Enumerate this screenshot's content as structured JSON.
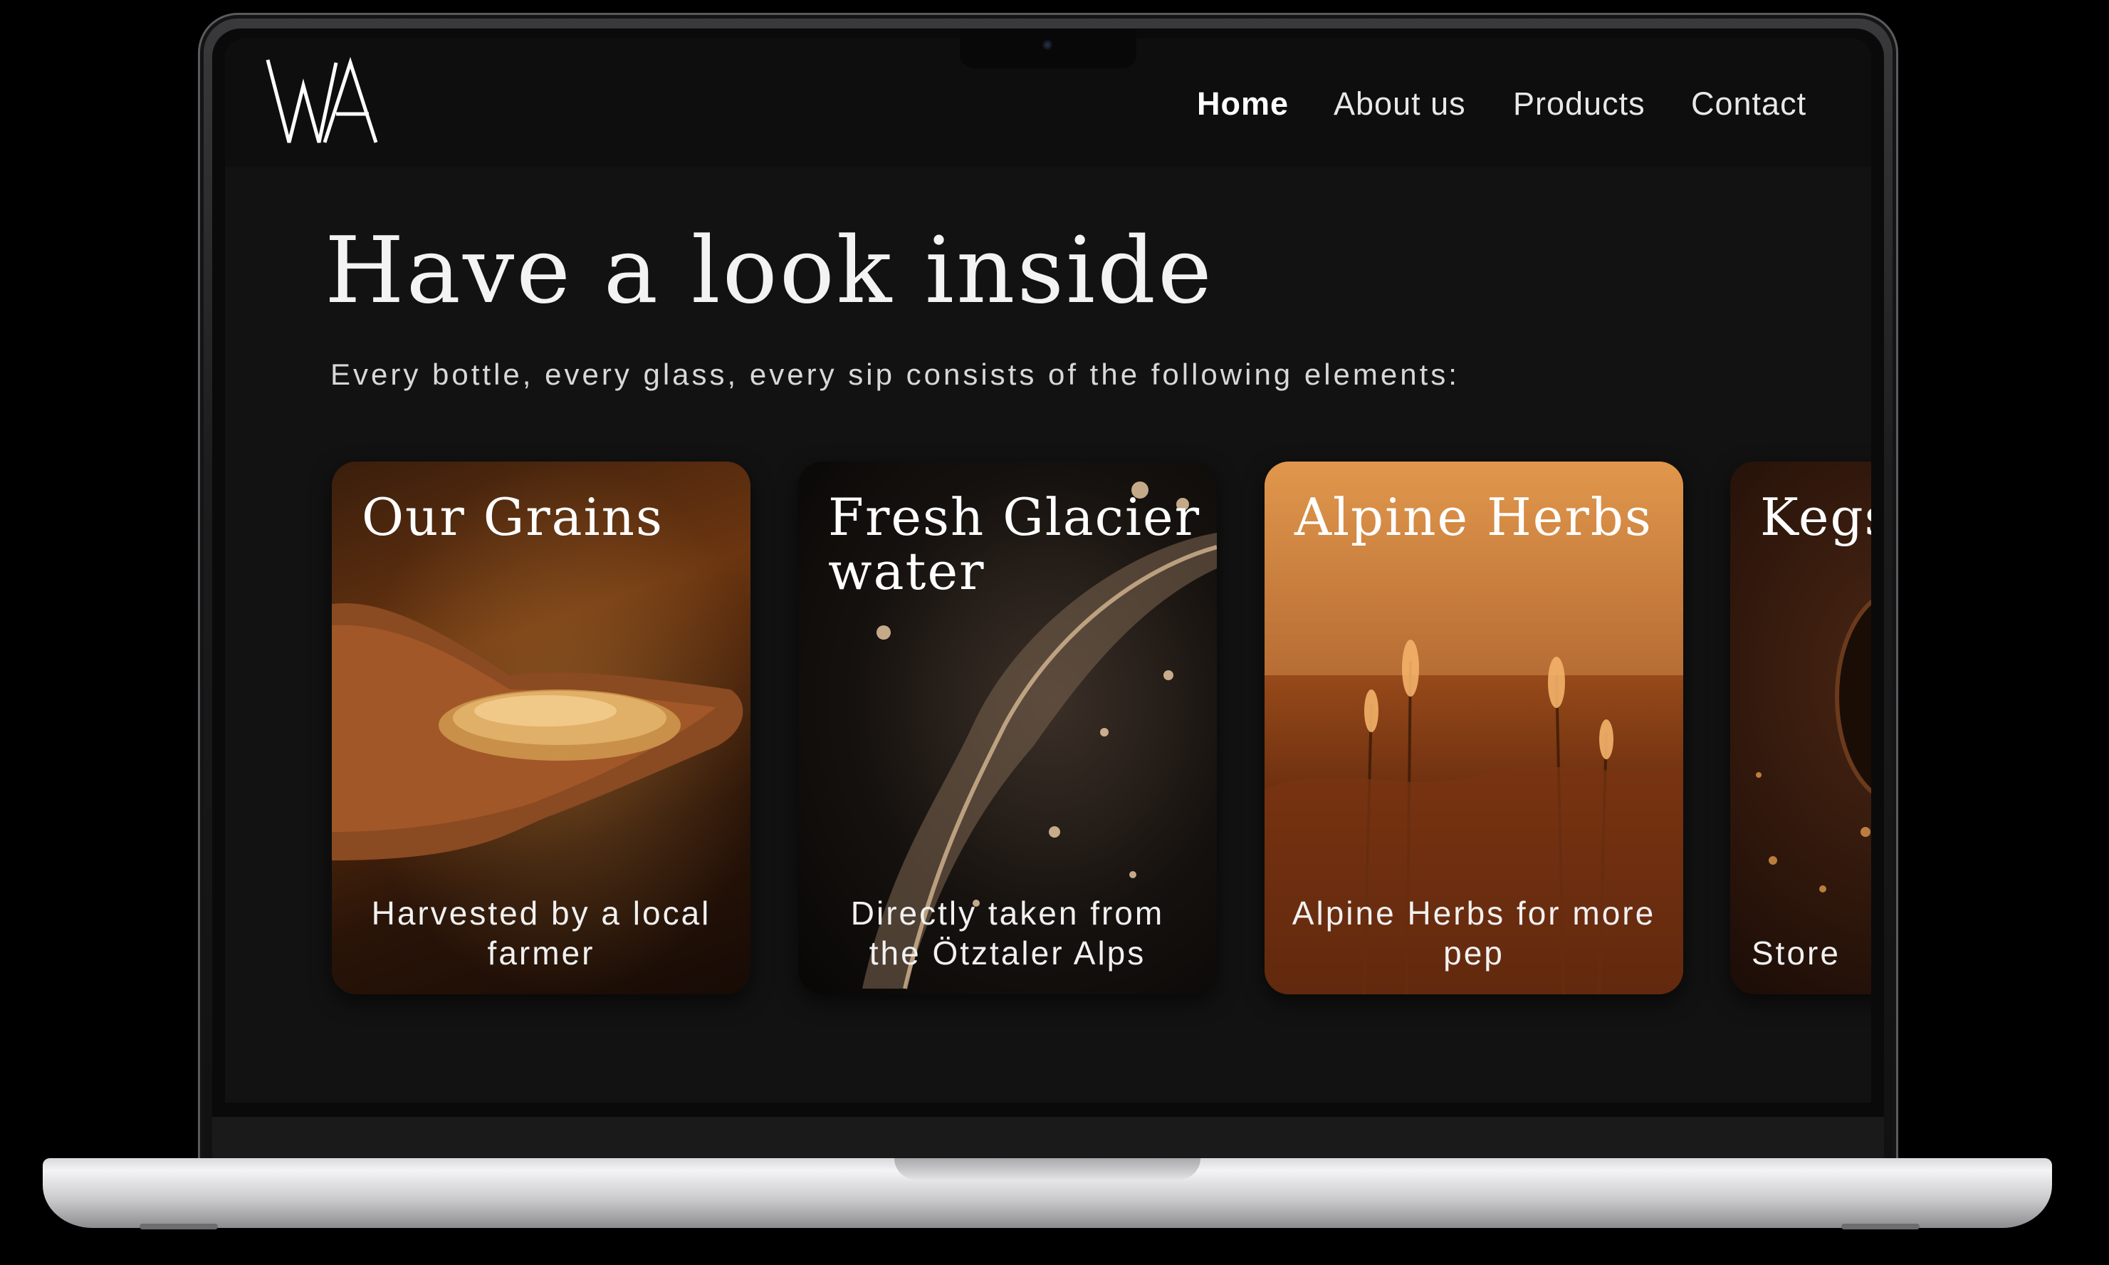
{
  "site": {
    "logo_text": "WA",
    "nav": {
      "home": "Home",
      "about": "About us",
      "products": "Products",
      "contact": "Contact"
    }
  },
  "hero": {
    "headline": "Have a look inside",
    "subtitle": "Every bottle, every glass, every sip consists of the following elements:"
  },
  "cards": [
    {
      "title": "Our Grains",
      "caption": "Harvested by a local farmer"
    },
    {
      "title": "Fresh Glacier water",
      "caption": "Directly taken from the Ötztaler Alps"
    },
    {
      "title": "Alpine Herbs",
      "caption": "Alpine Herbs for more pep"
    },
    {
      "title": "Kegs",
      "caption": "Store"
    }
  ]
}
